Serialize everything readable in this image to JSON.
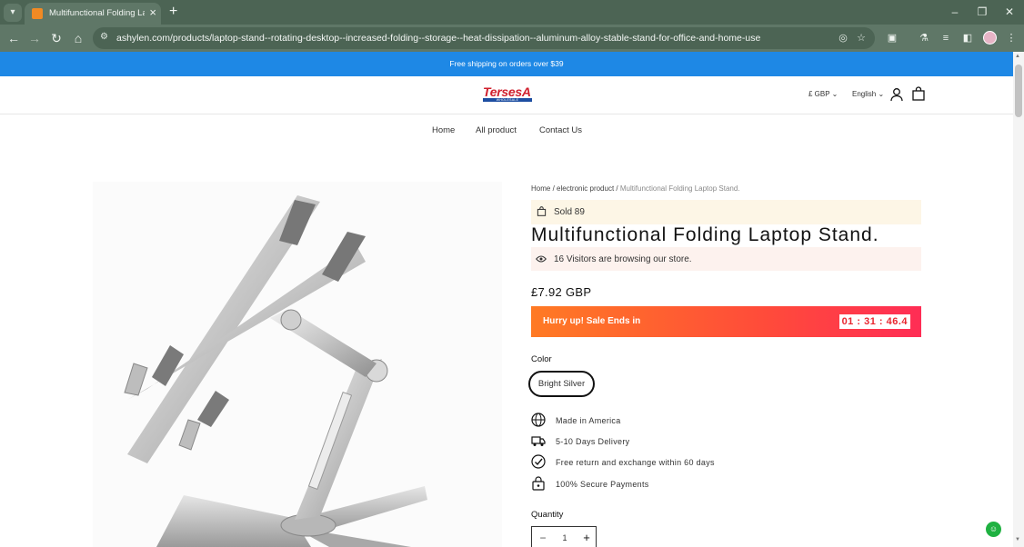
{
  "browser": {
    "tab_title": "Multifunctional Folding Laptop Stand.",
    "url": "ashylen.com/products/laptop-stand--rotating-desktop--increased-folding--storage--heat-dissipation--aluminum-alloy-stable-stand-for-office-and-home-use",
    "icons": [
      "tab-menu-icon",
      "close-icon",
      "plus-icon",
      "minimize-icon",
      "restore-icon",
      "back-icon",
      "forward-icon",
      "reload-icon",
      "home-icon",
      "site-info-icon",
      "eye-off-icon",
      "star-icon",
      "extensions-icon",
      "labs-icon",
      "media-icon",
      "sidebar-icon",
      "more-icon"
    ]
  },
  "announcement": {
    "text": "Free shipping on orders over $39"
  },
  "header": {
    "logo_text": "TersesA",
    "logo_subtext": "WHOLESALE",
    "currency": "£ GBP",
    "language": "English"
  },
  "menu": [
    "Home",
    "All product",
    "Contact Us"
  ],
  "breadcrumb": {
    "home": "Home",
    "category": "electronic product",
    "current": "Multifunctional Folding Laptop Stand."
  },
  "product": {
    "sold": "Sold 89",
    "title": "Multifunctional Folding Laptop Stand.",
    "visitors": "16 Visitors are browsing our store.",
    "price": "£7.92 GBP",
    "sale_text": "Hurry up! Sale Ends in",
    "countdown": "01 : 31 : 46.4",
    "color_label": "Color",
    "color_option": "Bright Silver",
    "features": [
      "Made in America",
      "5-10 Days Delivery",
      "Free return and exchange within 60 days",
      "100% Secure Payments"
    ],
    "quantity_label": "Quantity",
    "quantity": "1"
  },
  "colors": {
    "announcement_bg": "#1e88e5",
    "accent_red": "#e8262f",
    "sold_bg": "#fdf6e6",
    "visitors_bg": "#fdf2ee"
  }
}
